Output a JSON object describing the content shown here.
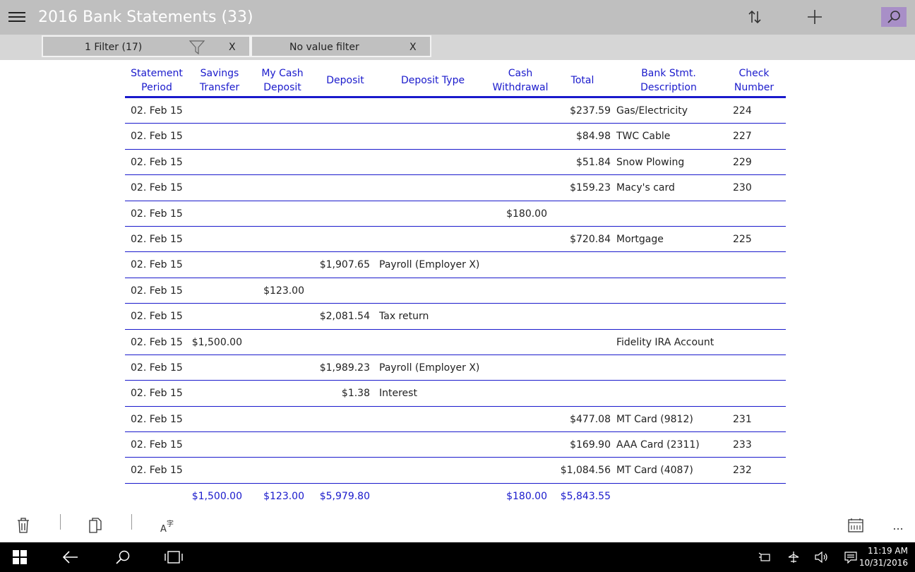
{
  "app": {
    "title": "2016 Bank Statements (33)"
  },
  "toolbar": {
    "sort_icon": "sort-icon",
    "add_icon": "add-icon",
    "search_icon": "search-icon",
    "search_accent": "#a88fc7"
  },
  "filters": [
    {
      "label": "1 Filter (17)",
      "close": "X"
    },
    {
      "label": "No value filter",
      "close": "X"
    }
  ],
  "table": {
    "accent": "#1a1acc",
    "columns": [
      {
        "line1": "Statement",
        "line2": "Period"
      },
      {
        "line1": "Savings",
        "line2": "Transfer"
      },
      {
        "line1": "My Cash",
        "line2": "Deposit"
      },
      {
        "line1": "Deposit",
        "line2": ""
      },
      {
        "line1": "Deposit Type",
        "line2": ""
      },
      {
        "line1": "Cash",
        "line2": "Withdrawal"
      },
      {
        "line1": "Total",
        "line2": ""
      },
      {
        "line1": "Bank Stmt.",
        "line2": "Description"
      },
      {
        "line1": "Check",
        "line2": "Number"
      }
    ],
    "rows": [
      [
        "02. Feb 15",
        "",
        "",
        "",
        "",
        "",
        "$237.59",
        "Gas/Electricity",
        "224"
      ],
      [
        "02. Feb 15",
        "",
        "",
        "",
        "",
        "",
        "$84.98",
        "TWC Cable",
        "227"
      ],
      [
        "02. Feb 15",
        "",
        "",
        "",
        "",
        "",
        "$51.84",
        "Snow Plowing",
        "229"
      ],
      [
        "02. Feb 15",
        "",
        "",
        "",
        "",
        "",
        "$159.23",
        "Macy's card",
        "230"
      ],
      [
        "02. Feb 15",
        "",
        "",
        "",
        "",
        "$180.00",
        "",
        "",
        ""
      ],
      [
        "02. Feb 15",
        "",
        "",
        "",
        "",
        "",
        "$720.84",
        "Mortgage",
        "225"
      ],
      [
        "02. Feb 15",
        "",
        "",
        "$1,907.65",
        "Payroll (Employer X)",
        "",
        "",
        "",
        ""
      ],
      [
        "02. Feb 15",
        "",
        "$123.00",
        "",
        "",
        "",
        "",
        "",
        ""
      ],
      [
        "02. Feb 15",
        "",
        "",
        "$2,081.54",
        "Tax return",
        "",
        "",
        "",
        ""
      ],
      [
        "02. Feb 15",
        "$1,500.00",
        "",
        "",
        "",
        "",
        "",
        "Fidelity IRA Account",
        ""
      ],
      [
        "02. Feb 15",
        "",
        "",
        "$1,989.23",
        "Payroll (Employer X)",
        "",
        "",
        "",
        ""
      ],
      [
        "02. Feb 15",
        "",
        "",
        "$1.38",
        "Interest",
        "",
        "",
        "",
        ""
      ],
      [
        "02. Feb 15",
        "",
        "",
        "",
        "",
        "",
        "$477.08",
        "MT Card (9812)",
        "231"
      ],
      [
        "02. Feb 15",
        "",
        "",
        "",
        "",
        "",
        "$169.90",
        "AAA Card (2311)",
        "233"
      ],
      [
        "02. Feb 15",
        "",
        "",
        "",
        "",
        "",
        "$1,084.56",
        "MT Card (4087)",
        "232"
      ]
    ],
    "totals": [
      "",
      "$1,500.00",
      "$123.00",
      "$5,979.80",
      "",
      "$180.00",
      "$5,843.55",
      "",
      ""
    ]
  },
  "bottom_bar": {
    "icons": [
      "trash-icon",
      "copy-icon",
      "font-icon",
      "calendar-icon",
      "more-icon"
    ],
    "more_label": "..."
  },
  "taskbar": {
    "time": "11:19 AM",
    "date": "10/31/2016"
  }
}
